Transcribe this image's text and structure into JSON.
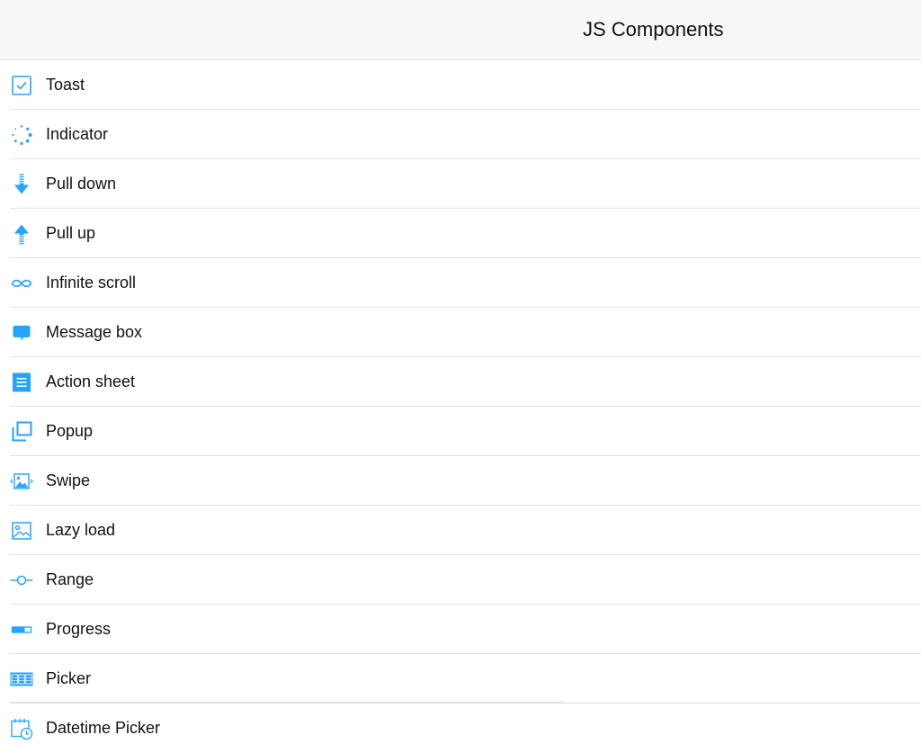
{
  "header": {
    "title": "JS Components"
  },
  "colors": {
    "accent": "#26a2ff",
    "navbar_bg": "#f7f7f7",
    "separator": "#e2e2e2"
  },
  "items": [
    {
      "label": "Toast",
      "icon": "checkbox-icon"
    },
    {
      "label": "Indicator",
      "icon": "spinner-icon"
    },
    {
      "label": "Pull down",
      "icon": "arrow-down-icon"
    },
    {
      "label": "Pull up",
      "icon": "arrow-up-icon"
    },
    {
      "label": "Infinite scroll",
      "icon": "infinity-icon"
    },
    {
      "label": "Message box",
      "icon": "message-bubble-icon"
    },
    {
      "label": "Action sheet",
      "icon": "list-sheet-icon"
    },
    {
      "label": "Popup",
      "icon": "popup-icon"
    },
    {
      "label": "Swipe",
      "icon": "swipe-image-icon"
    },
    {
      "label": "Lazy load",
      "icon": "image-icon"
    },
    {
      "label": "Range",
      "icon": "range-slider-icon"
    },
    {
      "label": "Progress",
      "icon": "progress-bar-icon"
    },
    {
      "label": "Picker",
      "icon": "picker-wheel-icon"
    },
    {
      "label": "Datetime Picker",
      "icon": "calendar-clock-icon"
    }
  ]
}
